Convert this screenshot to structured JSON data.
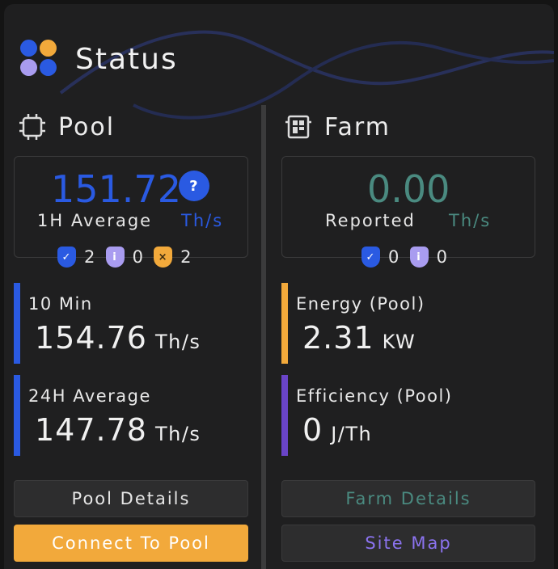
{
  "header": {
    "title": "Status"
  },
  "pool": {
    "title": "Pool",
    "hashrate_value": "151.72",
    "hashrate_label": "1H Average",
    "hashrate_unit": "Th/s",
    "help_label": "?",
    "badges": [
      {
        "icon": "check-shield",
        "count": "2"
      },
      {
        "icon": "info-shield",
        "count": "0"
      },
      {
        "icon": "error-shield",
        "count": "2"
      }
    ],
    "metrics": [
      {
        "label": "10 Min",
        "value": "154.76",
        "unit": "Th/s"
      },
      {
        "label": "24H Average",
        "value": "147.78",
        "unit": "Th/s"
      }
    ],
    "details_button": "Pool Details",
    "connect_button": "Connect To Pool"
  },
  "farm": {
    "title": "Farm",
    "hashrate_value": "0.00",
    "hashrate_label": "Reported",
    "hashrate_unit": "Th/s",
    "badges": [
      {
        "icon": "check-shield",
        "count": "0"
      },
      {
        "icon": "info-shield",
        "count": "0"
      }
    ],
    "metrics": [
      {
        "label": "Energy (Pool)",
        "value": "2.31",
        "unit": "KW"
      },
      {
        "label": "Efficiency (Pool)",
        "value": "0",
        "unit": "J/Th"
      }
    ],
    "details_button": "Farm Details",
    "sitemap_button": "Site Map"
  },
  "colors": {
    "blue": "#2a5ae2",
    "teal": "#4a8a80",
    "orange": "#f2a93b",
    "lavender": "#a99cf0",
    "purple": "#6a44c8",
    "link_purple": "#8b73ef"
  }
}
